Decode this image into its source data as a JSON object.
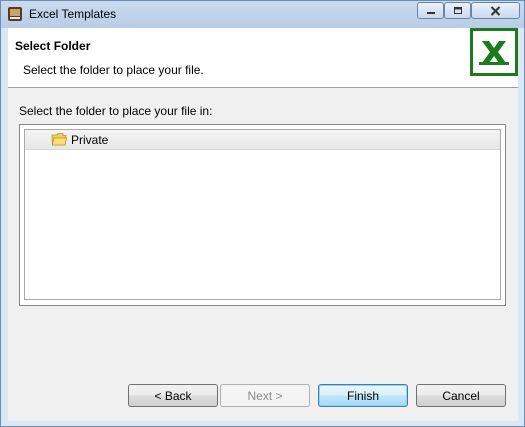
{
  "window": {
    "title": "Excel Templates"
  },
  "header": {
    "title": "Select Folder",
    "description": "Select the folder to place your file.",
    "logo_icon": "excel-logo-icon"
  },
  "body": {
    "label": "Select the folder to place your file in:",
    "folders": [
      {
        "label": "Private",
        "icon": "folder-icon",
        "selected": true
      }
    ]
  },
  "buttons": {
    "back": "< Back",
    "next": "Next >",
    "finish": "Finish",
    "cancel": "Cancel"
  },
  "colors": {
    "accent": "#3c7fb1",
    "excel_green": "#1d7a1d"
  }
}
